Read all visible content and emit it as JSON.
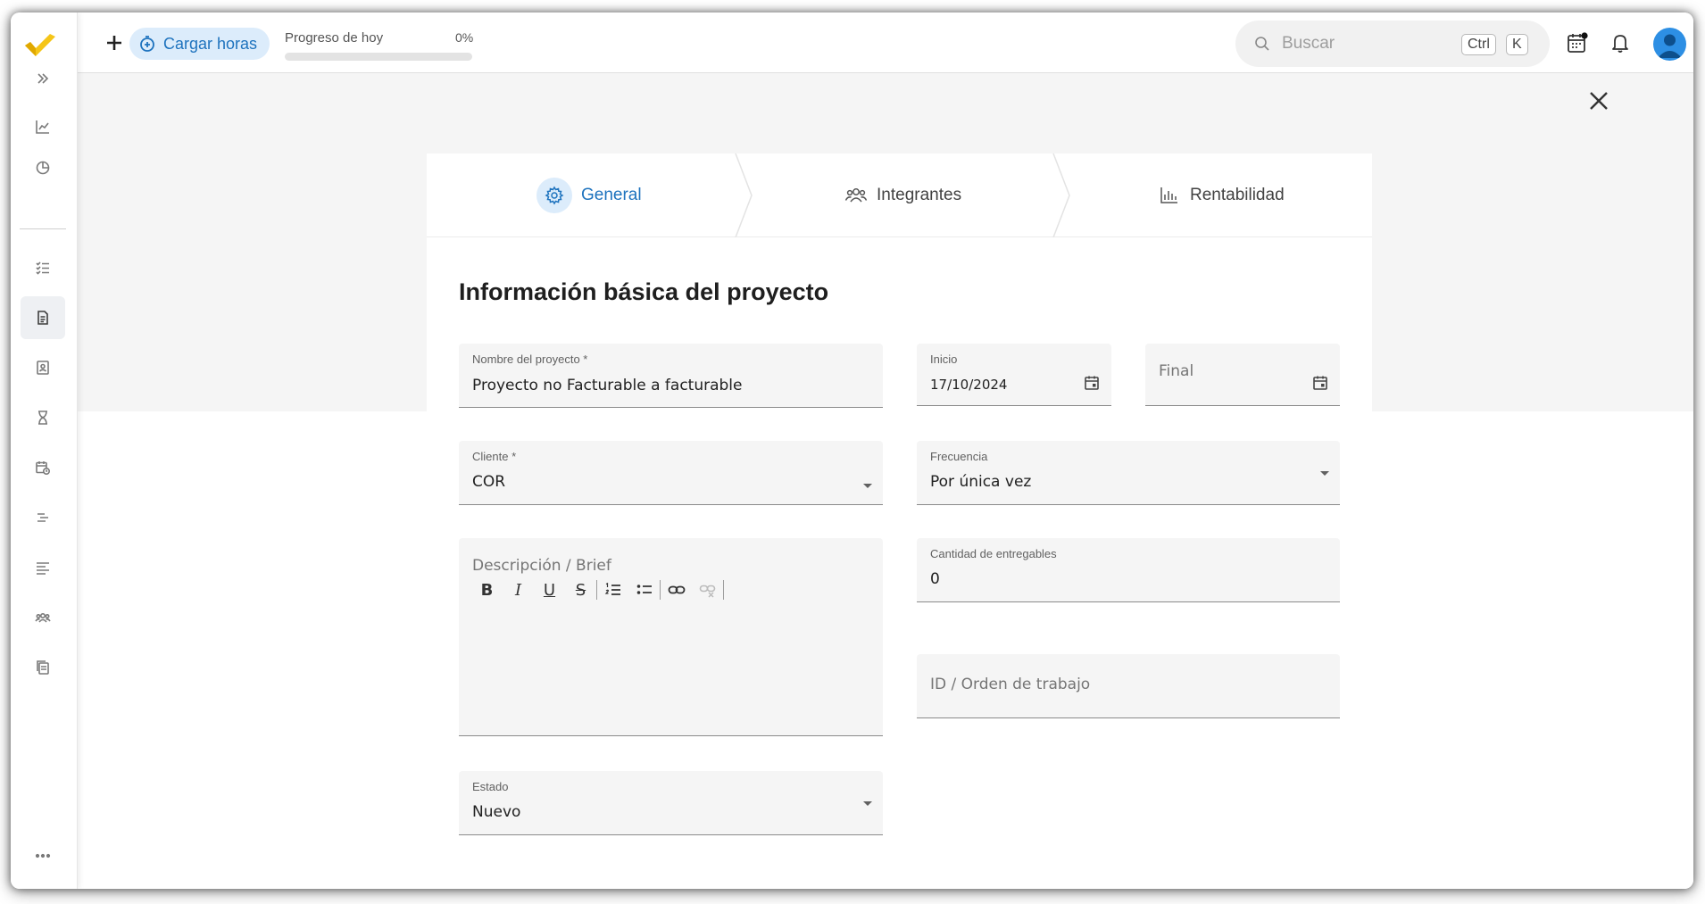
{
  "topbar": {
    "cargar_label": "Cargar horas",
    "progress_label": "Progreso de hoy",
    "progress_value": "0%",
    "progress_percent": 0,
    "search_placeholder": "Buscar",
    "shortcut_ctrl": "Ctrl",
    "shortcut_k": "K"
  },
  "steps": [
    {
      "label": "General",
      "icon": "gear-icon",
      "active": true
    },
    {
      "label": "Integrantes",
      "icon": "people-icon",
      "active": false
    },
    {
      "label": "Rentabilidad",
      "icon": "bar-chart-icon",
      "active": false
    }
  ],
  "form": {
    "title": "Información básica del proyecto",
    "nombre": {
      "label": "Nombre del proyecto *",
      "value": "Proyecto no Facturable a facturable"
    },
    "inicio": {
      "label": "Inicio",
      "value": "17/10/2024"
    },
    "final": {
      "placeholder": "Final"
    },
    "cliente": {
      "label": "Cliente *",
      "value": "COR"
    },
    "frecuencia": {
      "label": "Frecuencia",
      "value": "Por única vez"
    },
    "descripcion": {
      "placeholder": "Descripción / Brief"
    },
    "cantidad": {
      "label": "Cantidad de entregables",
      "value": "0"
    },
    "id_orden": {
      "placeholder": "ID / Orden de trabajo"
    },
    "estado": {
      "label": "Estado",
      "value": "Nuevo"
    },
    "editor_tools": {
      "bold": "B",
      "italic": "I",
      "underline": "U",
      "strike": "S"
    }
  },
  "colors": {
    "accent": "#1e73be",
    "accent_light": "#dcecfb",
    "logo": "#f5c518"
  }
}
